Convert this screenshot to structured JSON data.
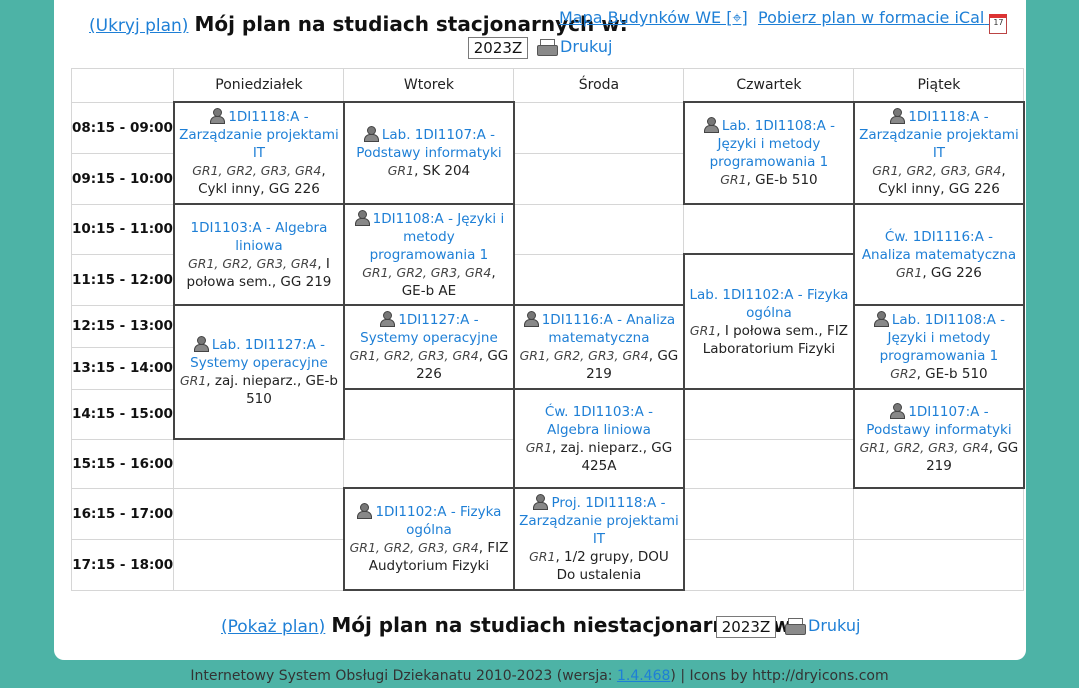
{
  "header1": {
    "toggle": "(Ukryj plan)",
    "title": "Mój plan na studiach stacjonarnych w:"
  },
  "links": {
    "map": "Mapa Budynków WE [⌖]",
    "ical": "Pobierz plan w formacie iCal",
    "semester": "2023Z",
    "print": "Drukuj"
  },
  "days": [
    "Poniedziałek",
    "Wtorek",
    "Środa",
    "Czwartek",
    "Piątek"
  ],
  "times": [
    "08:15 - 09:00",
    "09:15 - 10:00",
    "10:15 - 11:00",
    "11:15 - 12:00",
    "12:15 - 13:00",
    "13:15 - 14:00",
    "14:15 - 15:00",
    "15:15 - 16:00",
    "16:15 - 17:00",
    "17:15 - 18:00"
  ],
  "events": {
    "mon1": {
      "title": "1DI1118:A - Zarządzanie projektami IT",
      "groups": "GR1, GR2, GR3, GR4",
      "place": ", Cykl inny, GG 226"
    },
    "mon2": {
      "title": "1DI1103:A - Algebra liniowa",
      "groups": "GR1, GR2, GR3, GR4",
      "place": ", I połowa sem., GG 219"
    },
    "mon3": {
      "title": "Lab. 1DI1127:A - Systemy operacyjne",
      "groups": "GR1",
      "place": ", zaj. nieparz., GE-b 510"
    },
    "tue1": {
      "title": "Lab. 1DI1107:A - Podstawy informatyki",
      "groups": "GR1",
      "place": ", SK 204"
    },
    "tue2": {
      "title": "1DI1108:A - Języki i metody programowania 1",
      "groups": "GR1, GR2, GR3, GR4",
      "place": ", GE-b AE"
    },
    "tue3": {
      "title": "1DI1127:A - Systemy operacyjne",
      "groups": "GR1, GR2, GR3, GR4",
      "place": ", GG 226"
    },
    "tue4": {
      "title": "1DI1102:A - Fizyka ogólna",
      "groups": "GR1, GR2, GR3, GR4",
      "place": ", FIZ Audytorium Fizyki"
    },
    "wed1": {
      "title": "1DI1116:A - Analiza matematyczna",
      "groups": "GR1, GR2, GR3, GR4",
      "place": ", GG 219"
    },
    "wed2": {
      "title": "Ćw. 1DI1103:A - Algebra liniowa",
      "groups": "GR1",
      "place": ", zaj. nieparz., GG 425A"
    },
    "wed3": {
      "title": "Proj. 1DI1118:A - Zarządzanie projektami IT",
      "groups": "GR1",
      "place": ", 1/2 grupy, DOU Do ustalenia"
    },
    "thu1": {
      "title": "Lab. 1DI1108:A - Języki i metody programowania 1",
      "groups": "GR1",
      "place": ", GE-b 510"
    },
    "thu2": {
      "title": "Lab. 1DI1102:A - Fizyka ogólna",
      "groups": "GR1",
      "place": ", I połowa sem., FIZ Laboratorium Fizyki"
    },
    "fri1": {
      "title": "1DI1118:A - Zarządzanie projektami IT",
      "groups": "GR1, GR2, GR3, GR4",
      "place": ", Cykl inny, GG 226"
    },
    "fri2": {
      "title": "Ćw. 1DI1116:A - Analiza matematyczna",
      "groups": "GR1",
      "place": ", GG 226"
    },
    "fri3": {
      "title": "Lab. 1DI1108:A - Języki i metody programowania 1",
      "groups": "GR2",
      "place": ", GE-b 510"
    },
    "fri4": {
      "title": "1DI1107:A - Podstawy informatyki",
      "groups": "GR1, GR2, GR3, GR4",
      "place": ", GG 219"
    }
  },
  "header2": {
    "toggle": "(Pokaż plan)",
    "title": "Mój plan na studiach niestacjonarnych w:",
    "semester": "2023Z",
    "print": "Drukuj"
  },
  "footer": {
    "text": "Internetowy System Obsługi Dziekanatu 2010-2023 (wersja: ",
    "version": "1.4.468",
    "suffix": ") | Icons by http://dryicons.com"
  },
  "colors": {
    "background": "#4db3a6",
    "link": "#1e7fd6",
    "panel": "#ffffff"
  }
}
